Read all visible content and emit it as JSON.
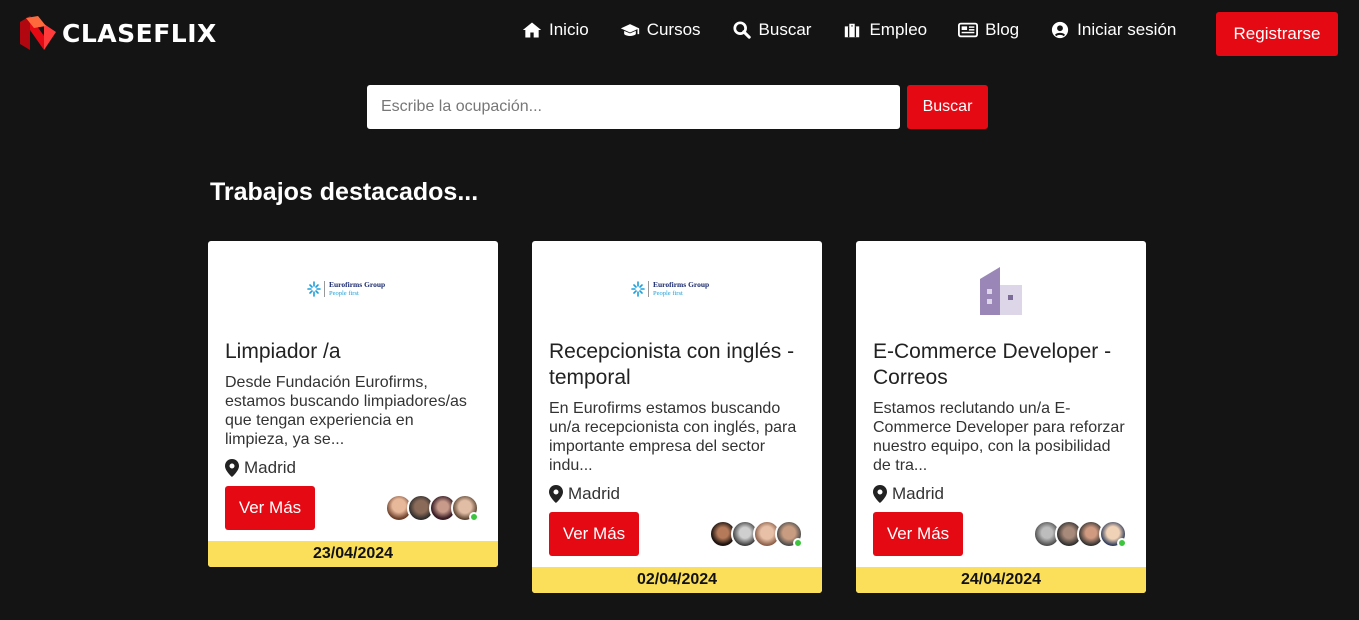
{
  "brand": {
    "name": "CLASEFLIX"
  },
  "nav": {
    "items": [
      {
        "label": "Inicio",
        "icon": "home-icon"
      },
      {
        "label": "Cursos",
        "icon": "graduation-cap-icon"
      },
      {
        "label": "Buscar",
        "icon": "search-icon"
      },
      {
        "label": "Empleo",
        "icon": "briefcase-icon"
      },
      {
        "label": "Blog",
        "icon": "newspaper-icon"
      },
      {
        "label": "Iniciar sesión",
        "icon": "user-circle-icon"
      }
    ],
    "register_label": "Registrarse"
  },
  "search": {
    "placeholder": "Escribe la ocupación...",
    "value": "",
    "button_label": "Buscar"
  },
  "section_title": "Trabajos destacados...",
  "jobs": [
    {
      "logo": "eurofirms-logo",
      "logo_text": {
        "line1": "Eurofirms Group",
        "line2": "People first"
      },
      "title": "Limpiador /a",
      "description": "Desde Fundación Eurofirms, estamos buscando limpiadores/as que tengan experiencia en limpieza, ya se...",
      "location": "Madrid",
      "button_label": "Ver Más",
      "date": "23/04/2024"
    },
    {
      "logo": "eurofirms-logo",
      "logo_text": {
        "line1": "Eurofirms Group",
        "line2": "People first"
      },
      "title": "Recepcionista con inglés - temporal",
      "description": "En Eurofirms estamos buscando un/a recepcionista con inglés, para importante empresa del sector indu...",
      "location": "Madrid",
      "button_label": "Ver Más",
      "date": "02/04/2024"
    },
    {
      "logo": "building-icon",
      "title": "E-Commerce Developer - Correos",
      "description": "Estamos reclutando un/a E-Commerce Developer para reforzar nuestro equipo, con la posibilidad de tra...",
      "location": "Madrid",
      "button_label": "Ver Más",
      "date": "24/04/2024"
    }
  ],
  "colors": {
    "accent": "#e50914",
    "date_bar": "#fbdf5a",
    "background": "#141414",
    "online": "#3ec53e",
    "building": "#9a87b8"
  }
}
